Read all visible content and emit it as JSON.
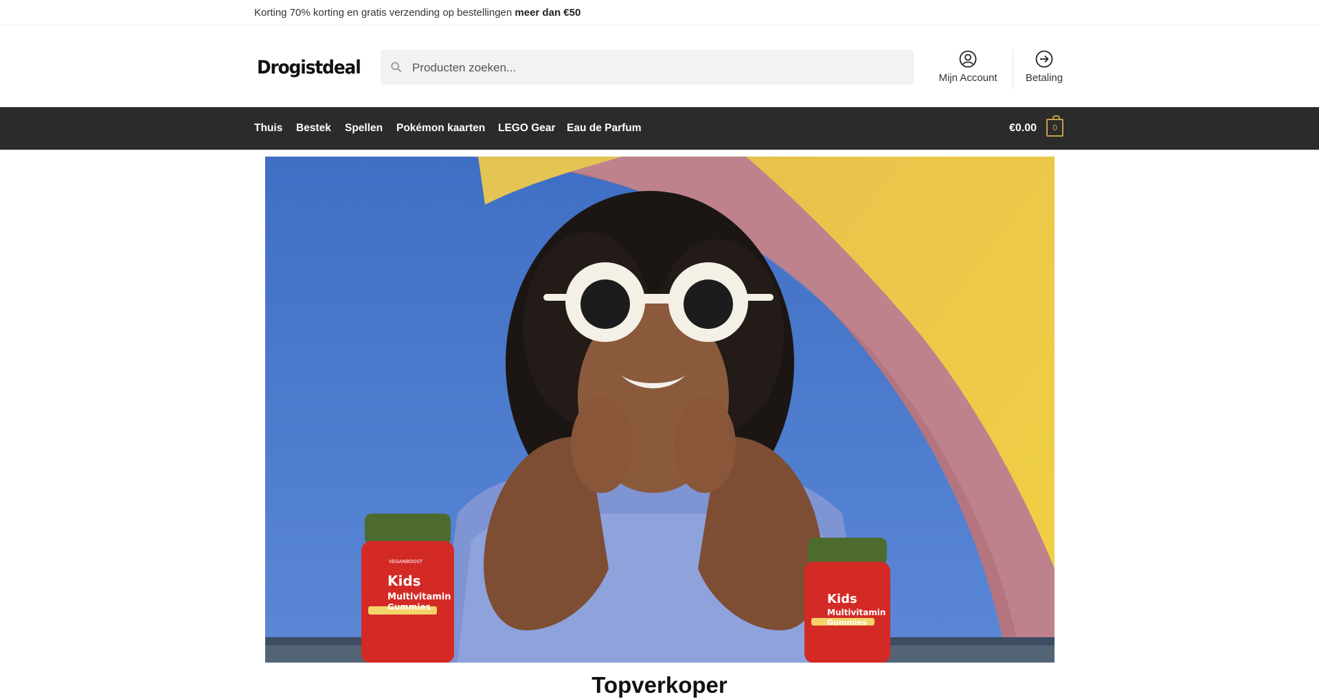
{
  "topbar": {
    "promo_text": "Korting 70% korting en gratis verzending op bestellingen ",
    "promo_bold": "meer dan €50"
  },
  "header": {
    "logo": "Drogistdeal",
    "search_placeholder": "Producten zoeken...",
    "account_label": "Mijn Account",
    "checkout_label": "Betaling"
  },
  "nav": {
    "items": [
      "Thuis",
      "Bestek",
      "Spellen",
      "Pokémon kaarten",
      "LEGO Gear",
      "Eau de Parfum"
    ]
  },
  "cart": {
    "total": "€0.00",
    "count": "0"
  },
  "hero": {
    "product_label_1": "Kids",
    "product_label_2": "Multivitamin",
    "product_label_3": "Gummies",
    "brand": "VEGANBOOST"
  },
  "section": {
    "title": "Topverkoper"
  },
  "colors": {
    "nav_bg": "#2b2b2b",
    "accent": "#c8a04a",
    "sky": "#4f7bcd"
  },
  "icons": {
    "search": "search-icon",
    "account": "user-circle-icon",
    "checkout": "arrow-circle-right-icon",
    "cart": "shopping-bag-icon"
  }
}
